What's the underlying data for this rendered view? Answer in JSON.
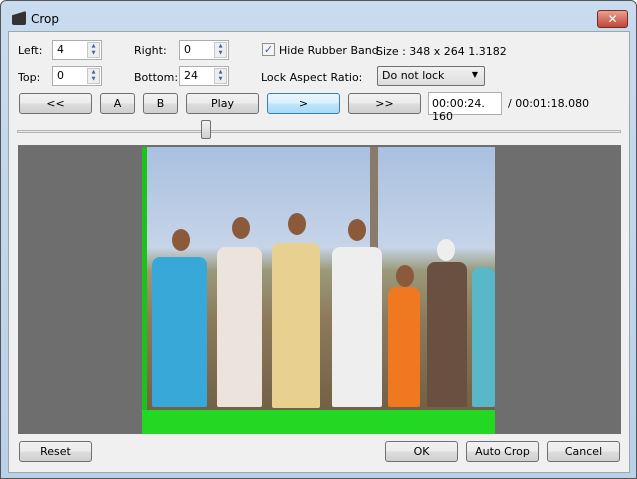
{
  "window": {
    "title": "Crop",
    "close_label": "✕"
  },
  "crop": {
    "left_label": "Left:",
    "left": "4",
    "right_label": "Right:",
    "right": "0",
    "top_label": "Top:",
    "top": "0",
    "bottom_label": "Bottom:",
    "bottom": "24"
  },
  "options": {
    "hide_rubber_band_label": "Hide Rubber Band",
    "hide_rubber_band": true,
    "size": "Size : 348 x 264   1.3182",
    "lock_aspect_label": "Lock Aspect Ratio:",
    "lock_aspect_value": "Do not lock"
  },
  "nav": {
    "rewind": "<<",
    "a": "A",
    "b": "B",
    "play": "Play",
    "next": ">",
    "forward": ">>",
    "current_time": "00:00:24. 160",
    "total_time": "/ 00:01:18.080"
  },
  "slider": {
    "position_fraction": 0.31
  },
  "footer": {
    "reset": "Reset",
    "ok": "OK",
    "auto_crop": "Auto Crop",
    "cancel": "Cancel"
  }
}
